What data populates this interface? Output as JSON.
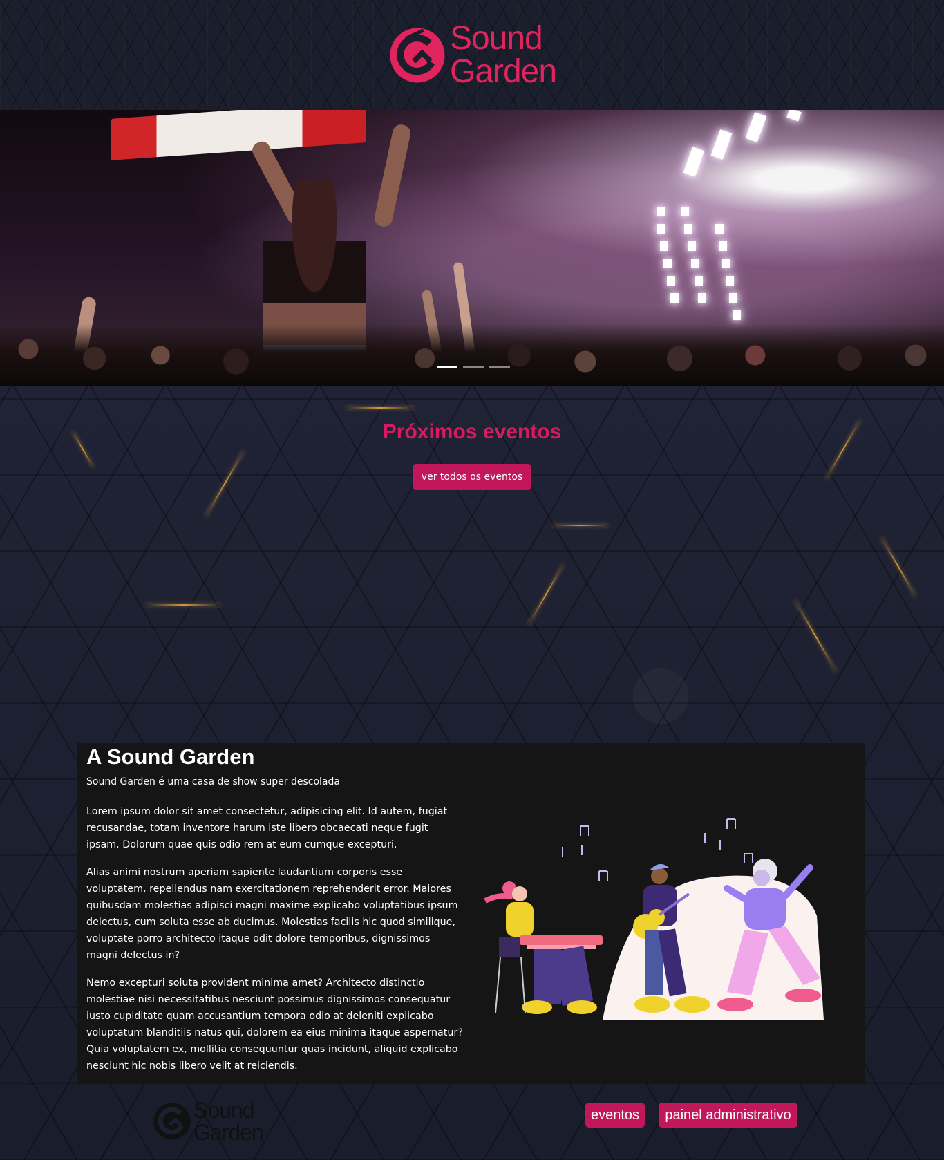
{
  "brand": {
    "name_line1": "Sound",
    "name_line2": "Garden",
    "color": "#e0245e",
    "icon": "sound-garden-logo-icon"
  },
  "hero": {
    "slides_count": 3,
    "active_slide": 1,
    "image_alt": "concert-crowd-image"
  },
  "events": {
    "title": "Próximos eventos",
    "button_label": "ver todos os eventos"
  },
  "about": {
    "title": "A Sound Garden",
    "subtitle": "Sound Garden é uma casa de show super descolada",
    "paragraphs": [
      "Lorem ipsum dolor sit amet consectetur, adipisicing elit. Id autem, fugiat recusandae, totam inventore harum iste libero obcaecati neque fugit ipsam. Dolorum quae quis odio rem at eum cumque excepturi.",
      "Alias animi nostrum aperiam sapiente laudantium corporis esse voluptatem, repellendus nam exercitationem reprehenderit error. Maiores quibusdam molestias adipisci magni maxime explicabo voluptatibus ipsum delectus, cum soluta esse ab ducimus. Molestias facilis hic quod similique, voluptate porro architecto itaque odit dolore temporibus, dignissimos magni delectus in?",
      "Nemo excepturi soluta provident minima amet? Architecto distinctio molestiae nisi necessitatibus nesciunt possimus dignissimos consequatur iusto cupiditate quam accusantium tempora odio at deleniti explicabo voluptatum blanditiis natus qui, dolorem ea eius minima itaque aspernatur? Quia voluptatem ex, mollitia consequuntur quas incidunt, aliquid explicabo nesciunt hic nobis libero velit at reiciendis."
    ],
    "illustration": "band-illustration"
  },
  "footer": {
    "brand_line1": "Sound",
    "brand_line2": "Garden",
    "nav": [
      {
        "label": "eventos"
      },
      {
        "label": "painel administrativo"
      }
    ]
  },
  "colors": {
    "accent": "#c2185b",
    "title_pink": "#d81b60",
    "about_bg": "#151515",
    "gold": "#d79b3a"
  }
}
